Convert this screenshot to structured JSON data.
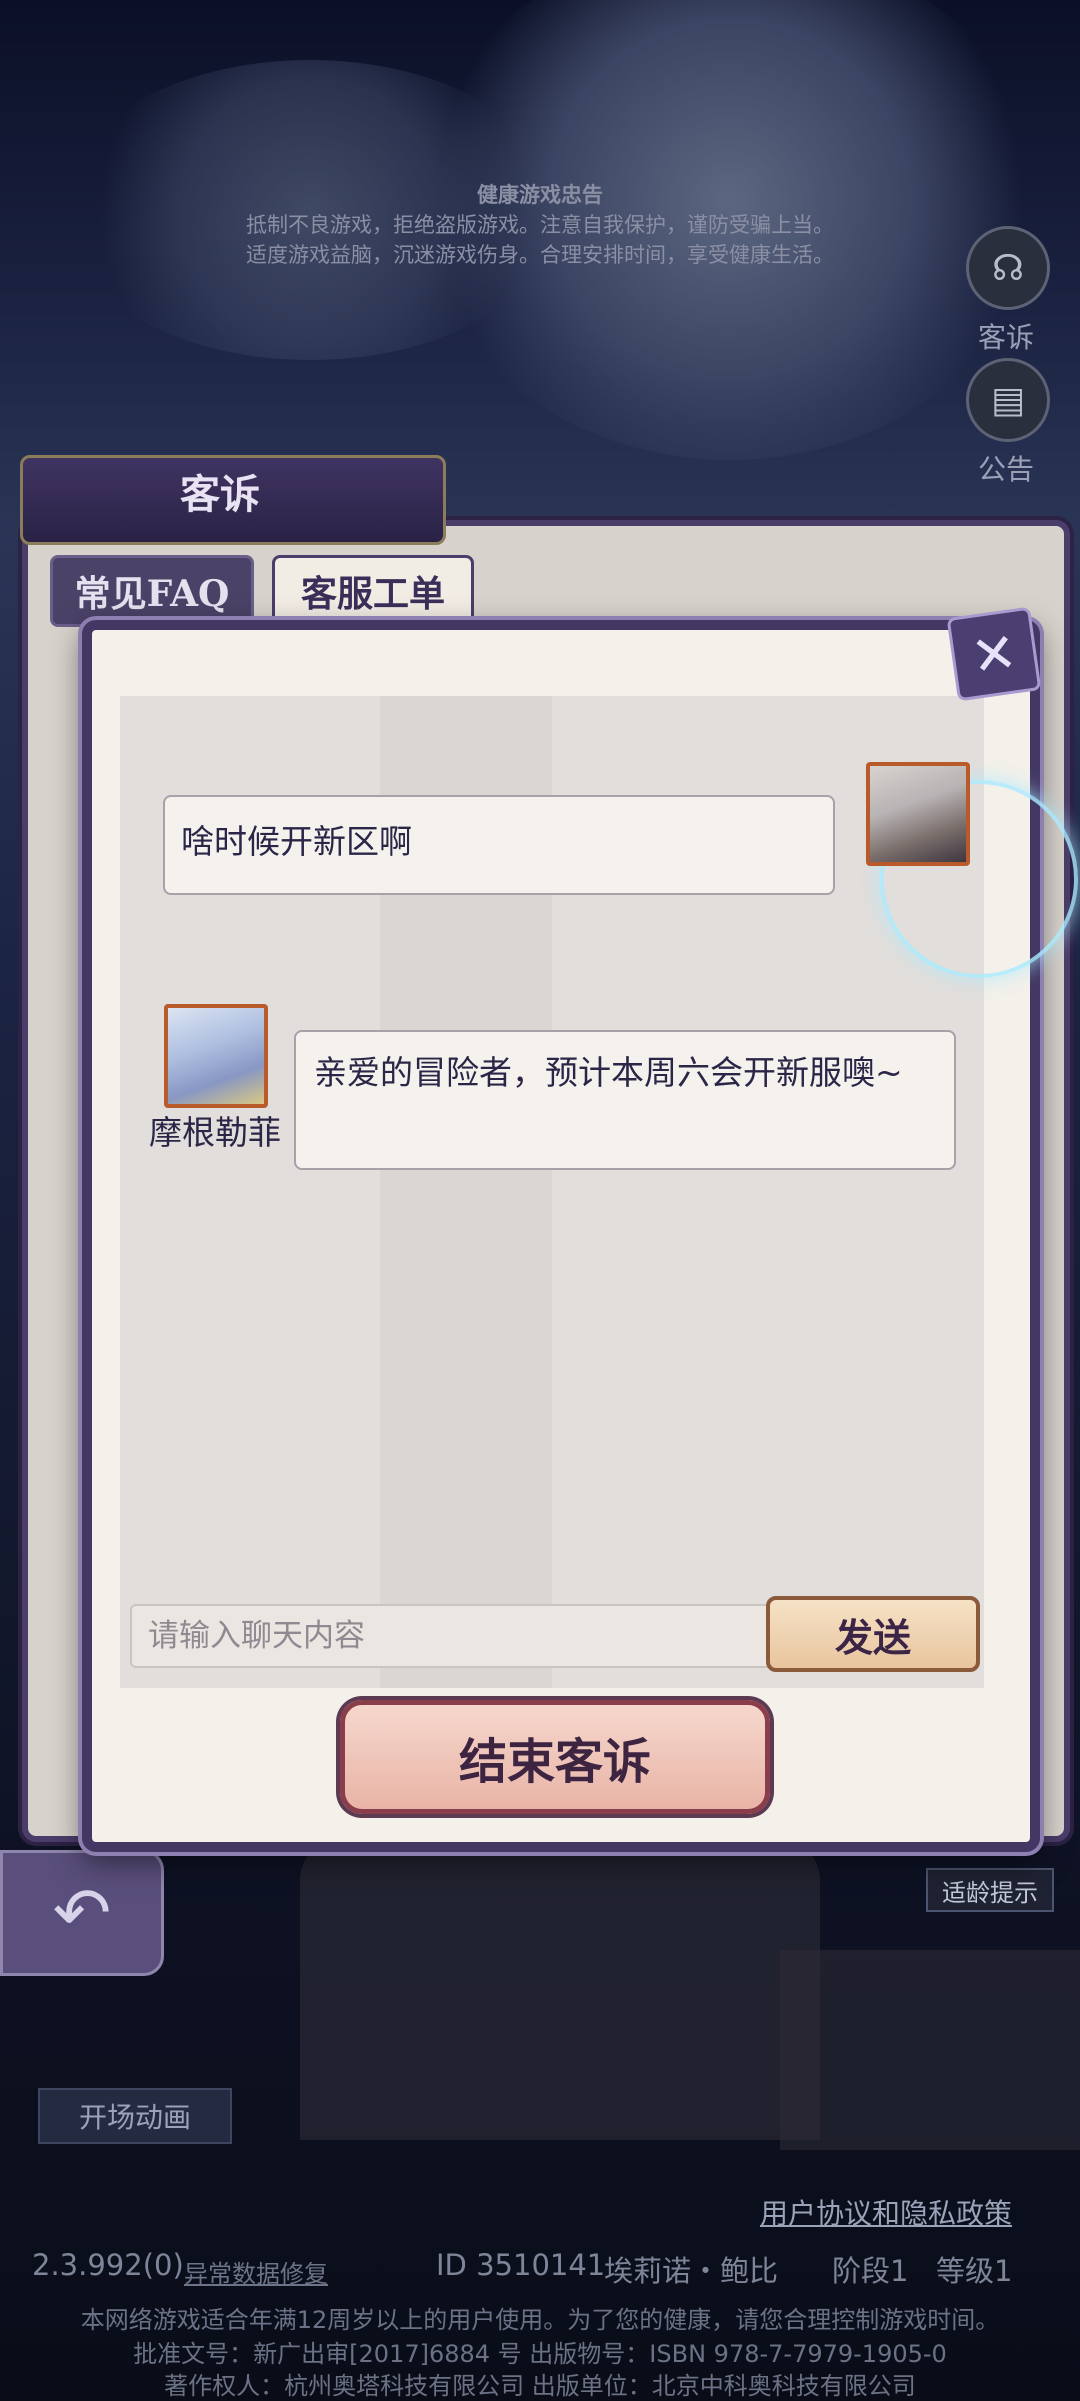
{
  "health_notice": {
    "title": "健康游戏忠告",
    "line1": "抵制不良游戏，拒绝盗版游戏。注意自我保护，谨防受骗上当。",
    "line2": "适度游戏益脑，沉迷游戏伤身。合理安排时间，享受健康生活。"
  },
  "side_menu": [
    {
      "label": "客诉",
      "icon": "headset-icon"
    },
    {
      "label": "公告",
      "icon": "notice-icon"
    }
  ],
  "panel": {
    "title": "客诉",
    "tabs": [
      {
        "label": "常见FAQ",
        "selected": false
      },
      {
        "label": "客服工单",
        "selected": true
      }
    ]
  },
  "chat": {
    "messages": [
      {
        "sender": "user",
        "text": "啥时候开新区啊"
      },
      {
        "sender": "agent",
        "name": "摩根勒菲",
        "text": "亲爱的冒险者，预计本周六会开新服噢~"
      }
    ],
    "input_placeholder": "请输入聊天内容",
    "send_label": "发送",
    "end_label": "结束客诉"
  },
  "bottom": {
    "opening_anim_label": "开场动画",
    "policy_link": "用户协议和隐私政策",
    "version": "2.3.992(0)",
    "repair_link": "异常数据修复",
    "player_id": "ID 3510141",
    "player_name": "埃莉诺・鲍比",
    "stage": "阶段1",
    "level": "等级1",
    "notice1": "本网络游戏适合年满12周岁以上的用户使用。为了您的健康，请您合理控制游戏时间。",
    "notice2": "批准文号：新广出审[2017]6884 号 出版物号：ISBN 978-7-7979-1905-0",
    "notice3": "著作权人：杭州奥塔科技有限公司 出版单位：北京中科奥科技有限公司",
    "age_hint": "适龄提示"
  }
}
